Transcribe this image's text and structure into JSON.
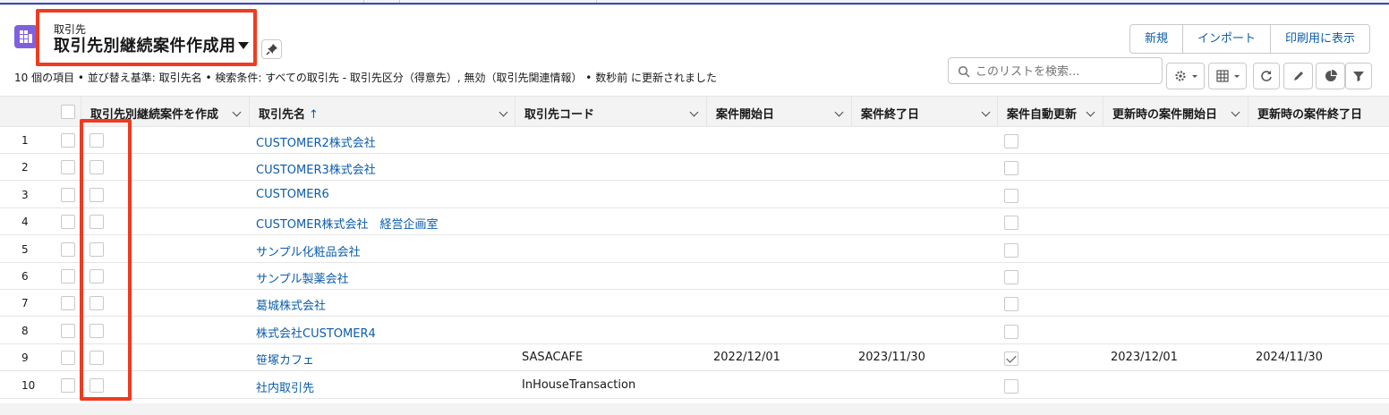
{
  "header": {
    "object_label": "取引先",
    "view_title": "取引先別継続案件作成用",
    "buttons": [
      "新規",
      "インポート",
      "印刷用に表示"
    ],
    "info_line": "10 個の項目 • 並び替え基準: 取引先名 • 検索条件: すべての取引先 - 取引先区分（得意先）, 無効（取引先関連情報） • 数秒前 に更新されました",
    "search_placeholder": "このリストを検索..."
  },
  "toolbar_icons": [
    "gear-icon",
    "table-view-icon",
    "refresh-icon",
    "pencil-icon",
    "pie-chart-icon",
    "filter-icon"
  ],
  "table": {
    "columns": [
      "取引先別継続案件を作成",
      "取引先名",
      "取引先コード",
      "案件開始日",
      "案件終了日",
      "案件自動更新",
      "更新時の案件開始日",
      "更新時の案件終了日"
    ],
    "sort_indicator": "↑",
    "rows": [
      {
        "num": "1",
        "name": "CUSTOMER2株式会社",
        "code": "",
        "start": "",
        "end": "",
        "auto": false,
        "rstart": "",
        "rend": ""
      },
      {
        "num": "2",
        "name": "CUSTOMER3株式会社",
        "code": "",
        "start": "",
        "end": "",
        "auto": false,
        "rstart": "",
        "rend": ""
      },
      {
        "num": "3",
        "name": "CUSTOMER6",
        "code": "",
        "start": "",
        "end": "",
        "auto": false,
        "rstart": "",
        "rend": ""
      },
      {
        "num": "4",
        "name": "CUSTOMER株式会社　経営企画室",
        "code": "",
        "start": "",
        "end": "",
        "auto": false,
        "rstart": "",
        "rend": ""
      },
      {
        "num": "5",
        "name": "サンプル化粧品会社",
        "code": "",
        "start": "",
        "end": "",
        "auto": false,
        "rstart": "",
        "rend": ""
      },
      {
        "num": "6",
        "name": "サンプル製薬会社",
        "code": "",
        "start": "",
        "end": "",
        "auto": false,
        "rstart": "",
        "rend": ""
      },
      {
        "num": "7",
        "name": "葛城株式会社",
        "code": "",
        "start": "",
        "end": "",
        "auto": false,
        "rstart": "",
        "rend": ""
      },
      {
        "num": "8",
        "name": "株式会社CUSTOMER4",
        "code": "",
        "start": "",
        "end": "",
        "auto": false,
        "rstart": "",
        "rend": ""
      },
      {
        "num": "9",
        "name": "笹塚カフェ",
        "code": "SASACAFE",
        "start": "2022/12/01",
        "end": "2023/11/30",
        "auto": true,
        "rstart": "2023/12/01",
        "rend": "2024/11/30"
      },
      {
        "num": "10",
        "name": "社内取引先",
        "code": "InHouseTransaction",
        "start": "",
        "end": "",
        "auto": false,
        "rstart": "",
        "rend": ""
      }
    ]
  },
  "colors": {
    "link": "#0b5cab",
    "highlight": "#f03b20",
    "object_icon": "#7f61df",
    "tab_accent": "#3b48c8"
  }
}
